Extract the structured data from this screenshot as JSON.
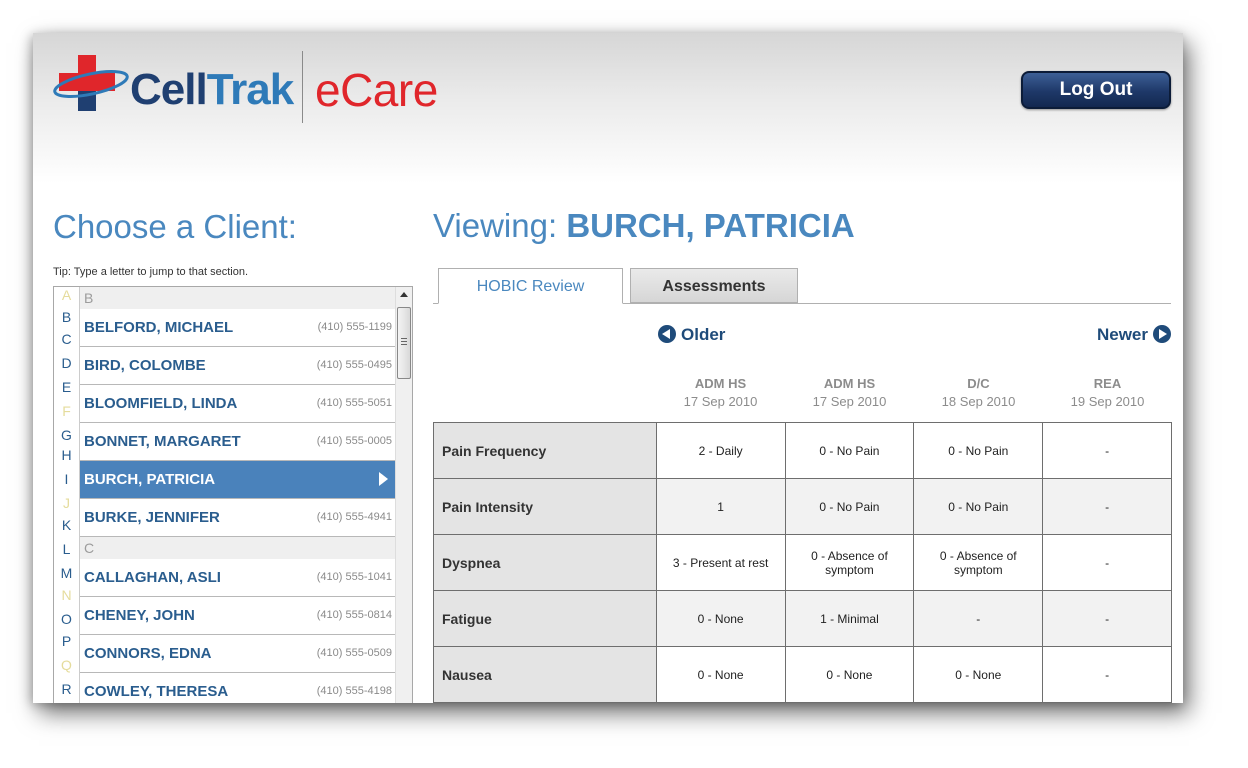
{
  "app": {
    "brand_cell": "Cell",
    "brand_trak": "Trak",
    "brand_product": "eCare"
  },
  "header": {
    "logout_label": "Log Out"
  },
  "sidebar": {
    "title": "Choose a Client:",
    "tip": "Tip: Type a letter to jump to that section.",
    "letters": [
      {
        "ch": "A",
        "enabled": false
      },
      {
        "ch": "B",
        "enabled": true
      },
      {
        "ch": "C",
        "enabled": true
      },
      {
        "ch": "D",
        "enabled": true
      },
      {
        "ch": "E",
        "enabled": true
      },
      {
        "ch": "F",
        "enabled": false
      },
      {
        "ch": "G",
        "enabled": true
      },
      {
        "ch": "H",
        "enabled": true
      },
      {
        "ch": "I",
        "enabled": true
      },
      {
        "ch": "J",
        "enabled": false
      },
      {
        "ch": "K",
        "enabled": true
      },
      {
        "ch": "L",
        "enabled": true
      },
      {
        "ch": "M",
        "enabled": true
      },
      {
        "ch": "N",
        "enabled": false
      },
      {
        "ch": "O",
        "enabled": true
      },
      {
        "ch": "P",
        "enabled": true
      },
      {
        "ch": "Q",
        "enabled": false
      },
      {
        "ch": "R",
        "enabled": true
      }
    ],
    "sections": [
      {
        "label": "B",
        "clients": [
          {
            "name": "BELFORD, MICHAEL",
            "phone": "(410) 555-1199"
          },
          {
            "name": "BIRD, COLOMBE",
            "phone": "(410) 555-0495"
          },
          {
            "name": "BLOOMFIELD, LINDA",
            "phone": "(410) 555-5051"
          },
          {
            "name": "BONNET, MARGARET",
            "phone": "(410) 555-0005"
          },
          {
            "name": "BURCH, PATRICIA",
            "phone": "",
            "selected": true
          },
          {
            "name": "BURKE, JENNIFER",
            "phone": "(410) 555-4941"
          }
        ]
      },
      {
        "label": "C",
        "clients": [
          {
            "name": "CALLAGHAN, ASLI",
            "phone": "(410) 555-1041"
          },
          {
            "name": "CHENEY, JOHN",
            "phone": "(410) 555-0814"
          },
          {
            "name": "CONNORS, EDNA",
            "phone": "(410) 555-0509"
          },
          {
            "name": "COWLEY, THERESA",
            "phone": "(410) 555-4198"
          }
        ]
      }
    ]
  },
  "main": {
    "viewing_label": "Viewing:",
    "client_name": "BURCH, PATRICIA",
    "tabs": [
      {
        "label": "HOBIC Review",
        "active": true
      },
      {
        "label": "Assessments",
        "active": false
      }
    ],
    "nav": {
      "older": "Older",
      "newer": "Newer"
    },
    "columns": [
      {
        "type": "ADM HS",
        "date": "17 Sep 2010"
      },
      {
        "type": "ADM HS",
        "date": "17 Sep 2010"
      },
      {
        "type": "D/C",
        "date": "18 Sep 2010"
      },
      {
        "type": "REA",
        "date": "19 Sep 2010"
      }
    ],
    "rows": [
      {
        "label": "Pain Frequency",
        "values": [
          "2 - Daily",
          "0 - No Pain",
          "0 - No Pain",
          "-"
        ]
      },
      {
        "label": "Pain Intensity",
        "values": [
          "1",
          "0 - No Pain",
          "0 - No Pain",
          "-"
        ]
      },
      {
        "label": "Dyspnea",
        "values": [
          "3 - Present at rest",
          "0 - Absence of symptom",
          "0 - Absence of symptom",
          "-"
        ]
      },
      {
        "label": "Fatigue",
        "values": [
          "0 - None",
          "1 - Minimal",
          "-",
          "-"
        ]
      },
      {
        "label": "Nausea",
        "values": [
          "0 - None",
          "0 - None",
          "0 - None",
          "-"
        ]
      }
    ]
  },
  "colors": {
    "accent": "#4a88bf",
    "dark_blue": "#1f4b7a",
    "brand_red": "#e0262b",
    "selected_row": "#4a82bb"
  }
}
